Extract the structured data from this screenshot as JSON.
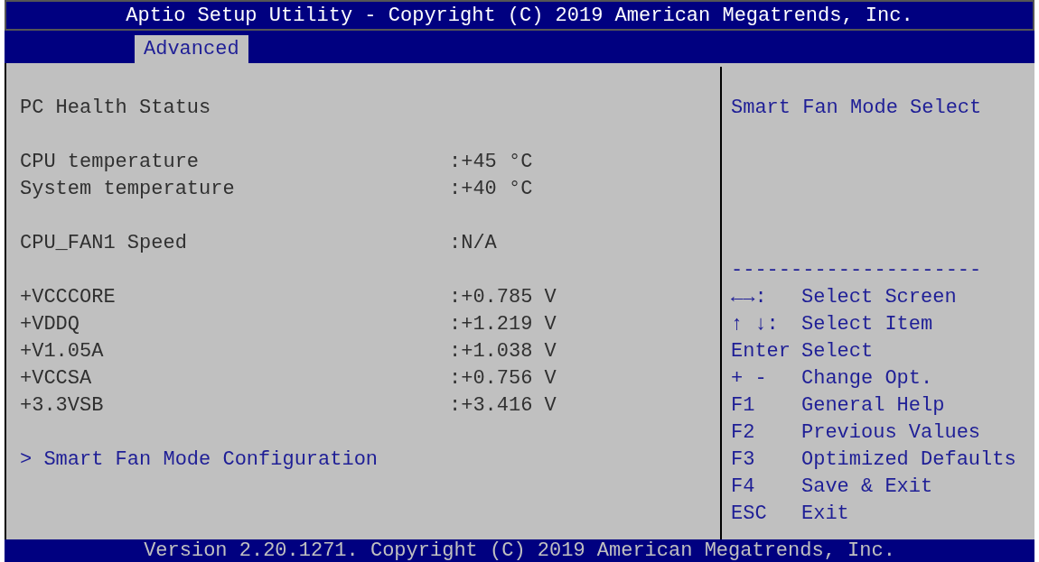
{
  "window": {
    "title": "Aptio Setup Utility - Copyright (C) 2019 American Megatrends, Inc."
  },
  "tabs": [
    {
      "label": "Advanced",
      "selected": true
    }
  ],
  "groups": [
    [
      {
        "kind": "heading",
        "label": "PC Health Status"
      }
    ],
    [
      {
        "kind": "reading",
        "label": "CPU temperature",
        "value": ":+45 °C"
      },
      {
        "kind": "reading",
        "label": "System temperature",
        "value": ":+40 °C"
      }
    ],
    [
      {
        "kind": "reading",
        "label": "CPU_FAN1 Speed",
        "value": ":N/A"
      }
    ],
    [
      {
        "kind": "reading",
        "label": "+VCCCORE",
        "value": ":+0.785 V"
      },
      {
        "kind": "reading",
        "label": "+VDDQ",
        "value": ":+1.219 V"
      },
      {
        "kind": "reading",
        "label": "+V1.05A",
        "value": ":+1.038 V"
      },
      {
        "kind": "reading",
        "label": "+VCCSA",
        "value": ":+0.756 V"
      },
      {
        "kind": "reading",
        "label": "+3.3VSB",
        "value": ":+3.416 V"
      }
    ],
    [
      {
        "kind": "submenu",
        "label": "> Smart Fan Mode Configuration"
      }
    ]
  ],
  "help": {
    "text": "Smart Fan Mode Select",
    "separator": "---------------------"
  },
  "keys": [
    {
      "key": "←→:",
      "action": "Select Screen"
    },
    {
      "key": "↑ ↓:",
      "action": "Select Item"
    },
    {
      "key": "Enter",
      "action": "Select"
    },
    {
      "key": "+ -",
      "action": "Change Opt."
    },
    {
      "key": "F1",
      "action": "General Help"
    },
    {
      "key": "F2",
      "action": "Previous Values"
    },
    {
      "key": "F3",
      "action": "Optimized Defaults"
    },
    {
      "key": "F4",
      "action": "Save & Exit"
    },
    {
      "key": "ESC",
      "action": "Exit"
    }
  ],
  "footer": "Version 2.20.1271. Copyright (C) 2019 American Megatrends, Inc."
}
